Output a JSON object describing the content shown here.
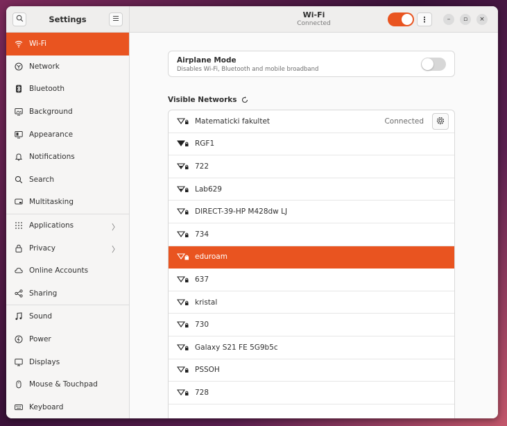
{
  "sidebar": {
    "title": "Settings",
    "items": [
      {
        "label": "Wi-Fi",
        "icon": "wifi-icon",
        "active": true
      },
      {
        "label": "Network",
        "icon": "network-icon"
      },
      {
        "label": "Bluetooth",
        "icon": "bluetooth-icon"
      },
      {
        "label": "Background",
        "icon": "background-icon"
      },
      {
        "label": "Appearance",
        "icon": "appearance-icon"
      },
      {
        "label": "Notifications",
        "icon": "bell-icon"
      },
      {
        "label": "Search",
        "icon": "search-icon"
      },
      {
        "label": "Multitasking",
        "icon": "multitasking-icon"
      },
      {
        "label": "Applications",
        "icon": "apps-grid-icon",
        "chevron": true
      },
      {
        "label": "Privacy",
        "icon": "lock-icon",
        "chevron": true
      },
      {
        "label": "Online Accounts",
        "icon": "cloud-icon"
      },
      {
        "label": "Sharing",
        "icon": "share-icon"
      },
      {
        "label": "Sound",
        "icon": "music-note-icon"
      },
      {
        "label": "Power",
        "icon": "power-icon"
      },
      {
        "label": "Displays",
        "icon": "display-icon"
      },
      {
        "label": "Mouse & Touchpad",
        "icon": "mouse-icon"
      },
      {
        "label": "Keyboard",
        "icon": "keyboard-icon"
      }
    ]
  },
  "header": {
    "title": "Wi-Fi",
    "subtitle": "Connected",
    "wifi_enabled": true,
    "menu_glyph": "⋮",
    "minimize_glyph": "–",
    "maximize_glyph": "▫",
    "close_glyph": "×"
  },
  "airplane": {
    "title": "Airplane Mode",
    "subtitle": "Disables Wi-Fi, Bluetooth and mobile broadband",
    "enabled": false
  },
  "networks": {
    "heading": "Visible Networks",
    "items": [
      {
        "name": "Matematicki fakultet",
        "status": "Connected"
      },
      {
        "name": "RGF1"
      },
      {
        "name": "722"
      },
      {
        "name": "Lab629"
      },
      {
        "name": "DIRECT-39-HP M428dw LJ"
      },
      {
        "name": "734"
      },
      {
        "name": "eduroam",
        "selected": true
      },
      {
        "name": "637"
      },
      {
        "name": "kristal"
      },
      {
        "name": "730"
      },
      {
        "name": "Galaxy S21 FE 5G9b5c"
      },
      {
        "name": "PSSOH"
      },
      {
        "name": "728"
      }
    ]
  },
  "colors": {
    "accent": "#e95420",
    "sidebar_bg": "#f6f5f4",
    "window_bg": "#fafafa"
  }
}
